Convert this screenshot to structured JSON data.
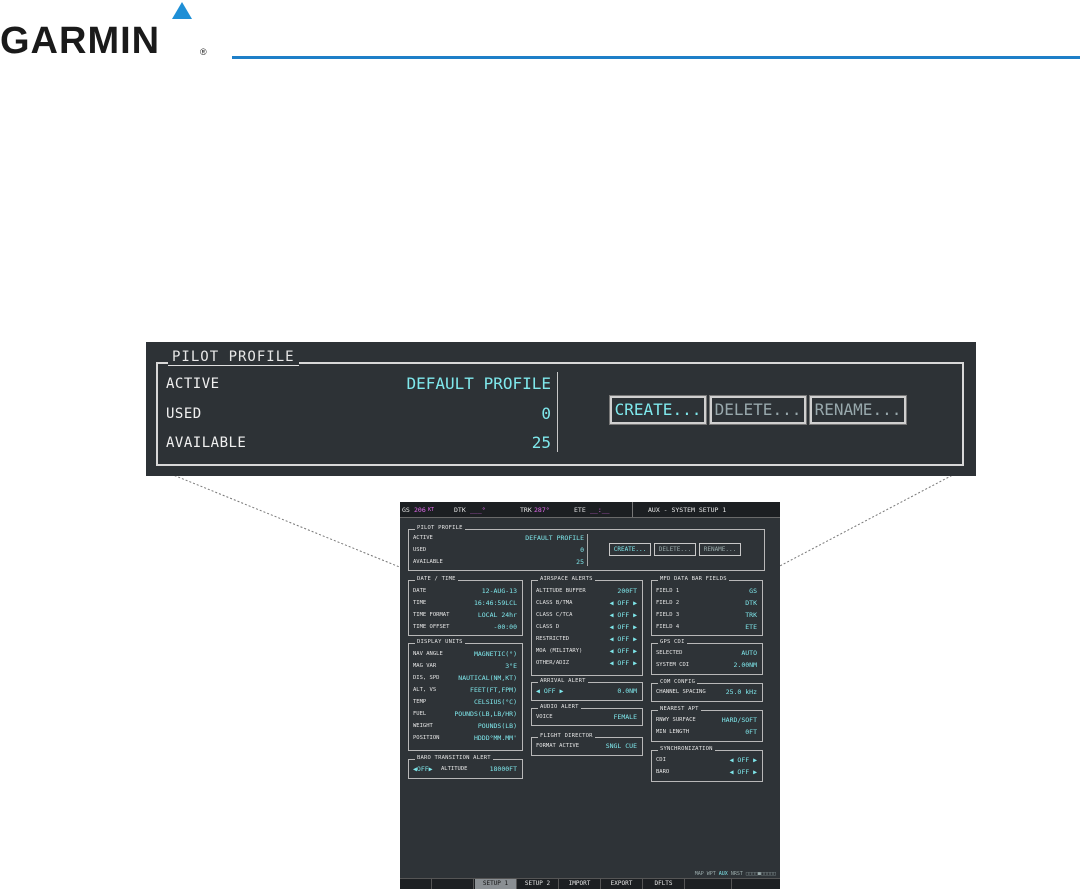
{
  "brand": {
    "name": "GARMIN",
    "reg": "®"
  },
  "zoom": {
    "legend": "PILOT PROFILE",
    "active_label": "ACTIVE",
    "active_value": "DEFAULT PROFILE",
    "used_label": "USED",
    "used_value": "0",
    "available_label": "AVAILABLE",
    "available_value": "25",
    "create": "CREATE...",
    "delete": "DELETE...",
    "rename": "RENAME..."
  },
  "screen": {
    "topbar": {
      "gs_label": "GS",
      "gs_value": "206",
      "gs_unit": "KT",
      "dtk_label": "DTK",
      "dtk_value": "___°",
      "trk_label": "TRK",
      "trk_value": "287°",
      "ete_label": "ETE",
      "ete_value": "__:__",
      "page_title": "AUX - SYSTEM SETUP 1"
    },
    "pilot_profile": {
      "legend": "PILOT PROFILE",
      "active_label": "ACTIVE",
      "active_value": "DEFAULT PROFILE",
      "used_label": "USED",
      "used_value": "0",
      "available_label": "AVAILABLE",
      "available_value": "25",
      "create": "CREATE...",
      "delete": "DELETE...",
      "rename": "RENAME..."
    },
    "date_time": {
      "legend": "DATE / TIME",
      "date_label": "DATE",
      "date_value": "12-AUG-13",
      "time_label": "TIME",
      "time_value": "16:46:59LCL",
      "format_label": "TIME FORMAT",
      "format_value": "LOCAL 24hr",
      "offset_label": "TIME OFFSET",
      "offset_value": "-00:00"
    },
    "display_units": {
      "legend": "DISPLAY UNITS",
      "rows": [
        {
          "k": "NAV ANGLE",
          "v": "MAGNETIC(°)"
        },
        {
          "k": "MAG VAR",
          "v": "3°E"
        },
        {
          "k": "DIS, SPD",
          "v": "NAUTICAL(NM,KT)"
        },
        {
          "k": "ALT, VS",
          "v": "FEET(FT,FPM)"
        },
        {
          "k": "TEMP",
          "v": "CELSIUS(°C)"
        },
        {
          "k": "FUEL",
          "v": "POUNDS(LB,LB/HR)"
        },
        {
          "k": "WEIGHT",
          "v": "POUNDS(LB)"
        },
        {
          "k": "POSITION",
          "v": "HDDD°MM.MM'"
        }
      ]
    },
    "baro_alert": {
      "legend": "BARO TRANSITION ALERT",
      "state": "◀OFF▶",
      "alt_label": "ALTITUDE",
      "alt_value": "18000FT"
    },
    "airspace_alerts": {
      "legend": "AIRSPACE ALERTS",
      "rows": [
        {
          "k": "ALTITUDE BUFFER",
          "v": "200FT"
        },
        {
          "k": "CLASS B/TMA",
          "v": "◀ OFF ▶"
        },
        {
          "k": "CLASS C/TCA",
          "v": "◀ OFF ▶"
        },
        {
          "k": "CLASS D",
          "v": "◀ OFF ▶"
        },
        {
          "k": "RESTRICTED",
          "v": "◀ OFF ▶"
        },
        {
          "k": "MOA (MILITARY)",
          "v": "◀ OFF ▶"
        },
        {
          "k": "OTHER/ADIZ",
          "v": "◀ OFF ▶"
        }
      ]
    },
    "arrival_alert": {
      "legend": "ARRIVAL ALERT",
      "state": "◀ OFF ▶",
      "value": "0.0NM"
    },
    "audio_alert": {
      "legend": "AUDIO ALERT",
      "k": "VOICE",
      "v": "FEMALE"
    },
    "flight_director": {
      "legend": "FLIGHT DIRECTOR",
      "k": "FORMAT ACTIVE",
      "v": "SNGL CUE"
    },
    "mfd_fields": {
      "legend": "MFD DATA BAR FIELDS",
      "rows": [
        {
          "k": "FIELD 1",
          "v": "GS"
        },
        {
          "k": "FIELD 2",
          "v": "DTK"
        },
        {
          "k": "FIELD 3",
          "v": "TRK"
        },
        {
          "k": "FIELD 4",
          "v": "ETE"
        }
      ]
    },
    "gps_cdi": {
      "legend": "GPS CDI",
      "selected_label": "SELECTED",
      "selected_value": "AUTO",
      "system_label": "SYSTEM CDI",
      "system_value": "2.00NM"
    },
    "com_config": {
      "legend": "COM CONFIG",
      "k": "CHANNEL SPACING",
      "v": "25.0 kHz"
    },
    "nearest_apt": {
      "legend": "NEAREST APT",
      "surface_label": "RNWY SURFACE",
      "surface_value": "HARD/SOFT",
      "min_label": "MIN LENGTH",
      "min_value": "0FT"
    },
    "sync": {
      "legend": "SYNCHRONIZATION",
      "cdi_label": "CDI",
      "cdi_value": "◀ OFF ▶",
      "baro_label": "BARO",
      "baro_value": "◀ OFF ▶"
    },
    "page_group": {
      "text": "MAP WPT",
      "current": "AUX",
      "rest": "NRST",
      "dots": "□□□□■□□□□□"
    },
    "softkeys": [
      "",
      "",
      "SETUP 1",
      "SETUP 2",
      "IMPORT",
      "EXPORT",
      "DFLTS",
      "",
      ""
    ]
  },
  "colors": {
    "accent_blue": "#1e7fc8",
    "cyan": "#7fe8ec",
    "magenta": "#e56cf0",
    "bezel": "#2e3337"
  }
}
